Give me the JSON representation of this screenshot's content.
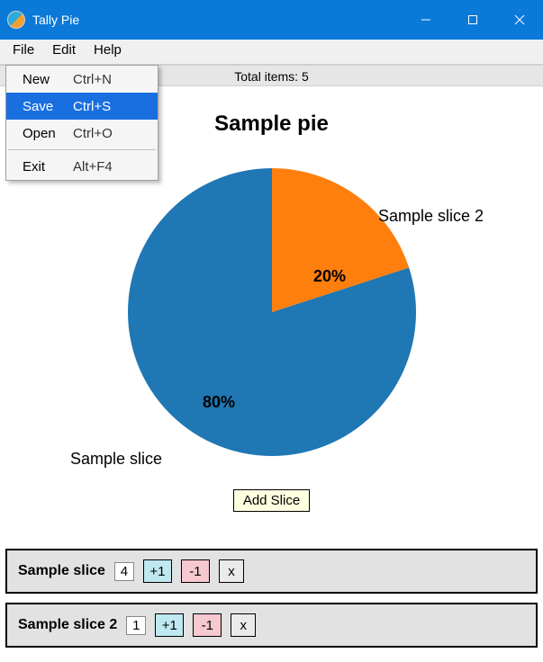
{
  "window": {
    "title": "Tally Pie"
  },
  "menubar": {
    "items": [
      "File",
      "Edit",
      "Help"
    ]
  },
  "dropdown": {
    "rows": [
      {
        "label": "New",
        "accel": "Ctrl+N"
      },
      {
        "label": "Save",
        "accel": "Ctrl+S"
      },
      {
        "label": "Open",
        "accel": "Ctrl+O"
      },
      {
        "label": "Exit",
        "accel": "Alt+F4"
      }
    ],
    "highlighted_index": 1
  },
  "total_label": "Total items: 5",
  "chart_title": "Sample pie",
  "chart_data": {
    "type": "pie",
    "title": "Sample pie",
    "series": [
      {
        "name": "Sample slice",
        "value": 4,
        "percent": 80,
        "color": "#1f77b4"
      },
      {
        "name": "Sample slice 2",
        "value": 1,
        "percent": 20,
        "color": "#ff7f0e"
      }
    ]
  },
  "add_slice_label": "Add Slice",
  "slice_rows": {
    "plus_label": "+1",
    "minus_label": "-1",
    "delete_label": "x",
    "items": [
      {
        "name": "Sample slice",
        "count": "4"
      },
      {
        "name": "Sample slice 2",
        "count": "1"
      }
    ]
  }
}
